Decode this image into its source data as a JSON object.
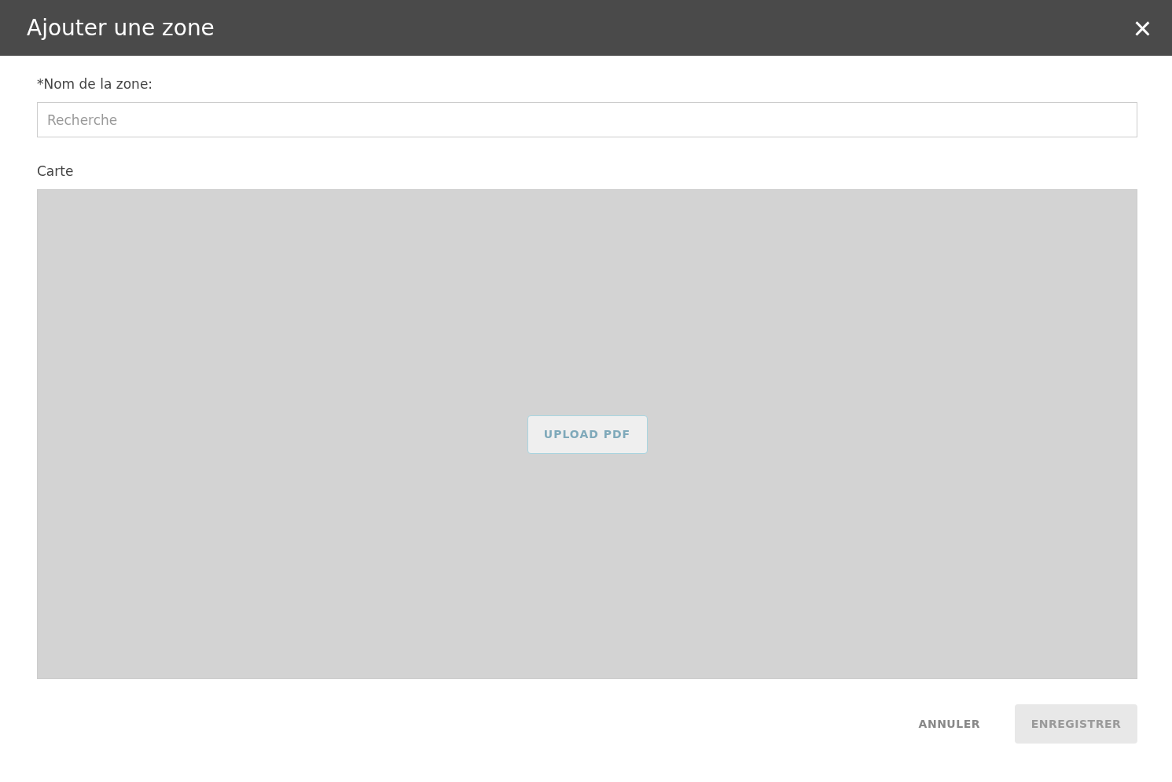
{
  "dialog": {
    "title": "Ajouter une zone",
    "close": "×"
  },
  "name_field": {
    "label": "*Nom de la zone:",
    "placeholder": "Recherche"
  },
  "map": {
    "label": "Carte",
    "upload_button": {
      "label": "UPLOAD PDF",
      "disabled": true
    }
  },
  "buttons": [
    {
      "label": "ANNULER",
      "kind": "text",
      "disabled": false
    },
    {
      "label": "ENREGISTRER",
      "kind": "filled",
      "disabled": true
    }
  ]
}
